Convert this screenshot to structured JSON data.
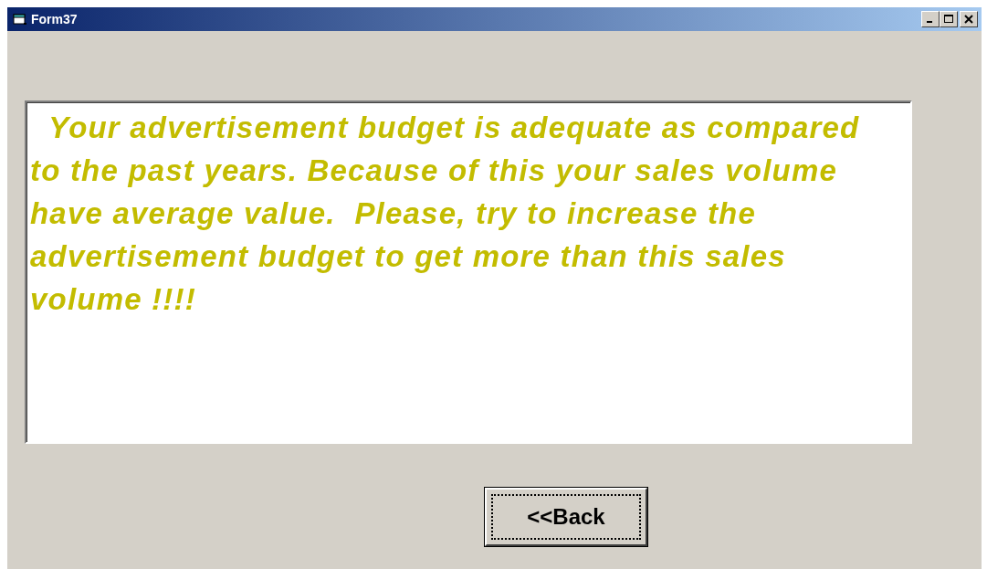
{
  "window": {
    "title": "Form37"
  },
  "message": {
    "lines": [
      "  Your advertisement budget is adequate as compared",
      "to the past years. Because of this your sales volume",
      "have average value.  Please, try to increase the",
      "advertisement budget to get more than this sales",
      "volume !!!!"
    ]
  },
  "buttons": [
    {
      "label": "<<Back",
      "focused": true
    }
  ]
}
